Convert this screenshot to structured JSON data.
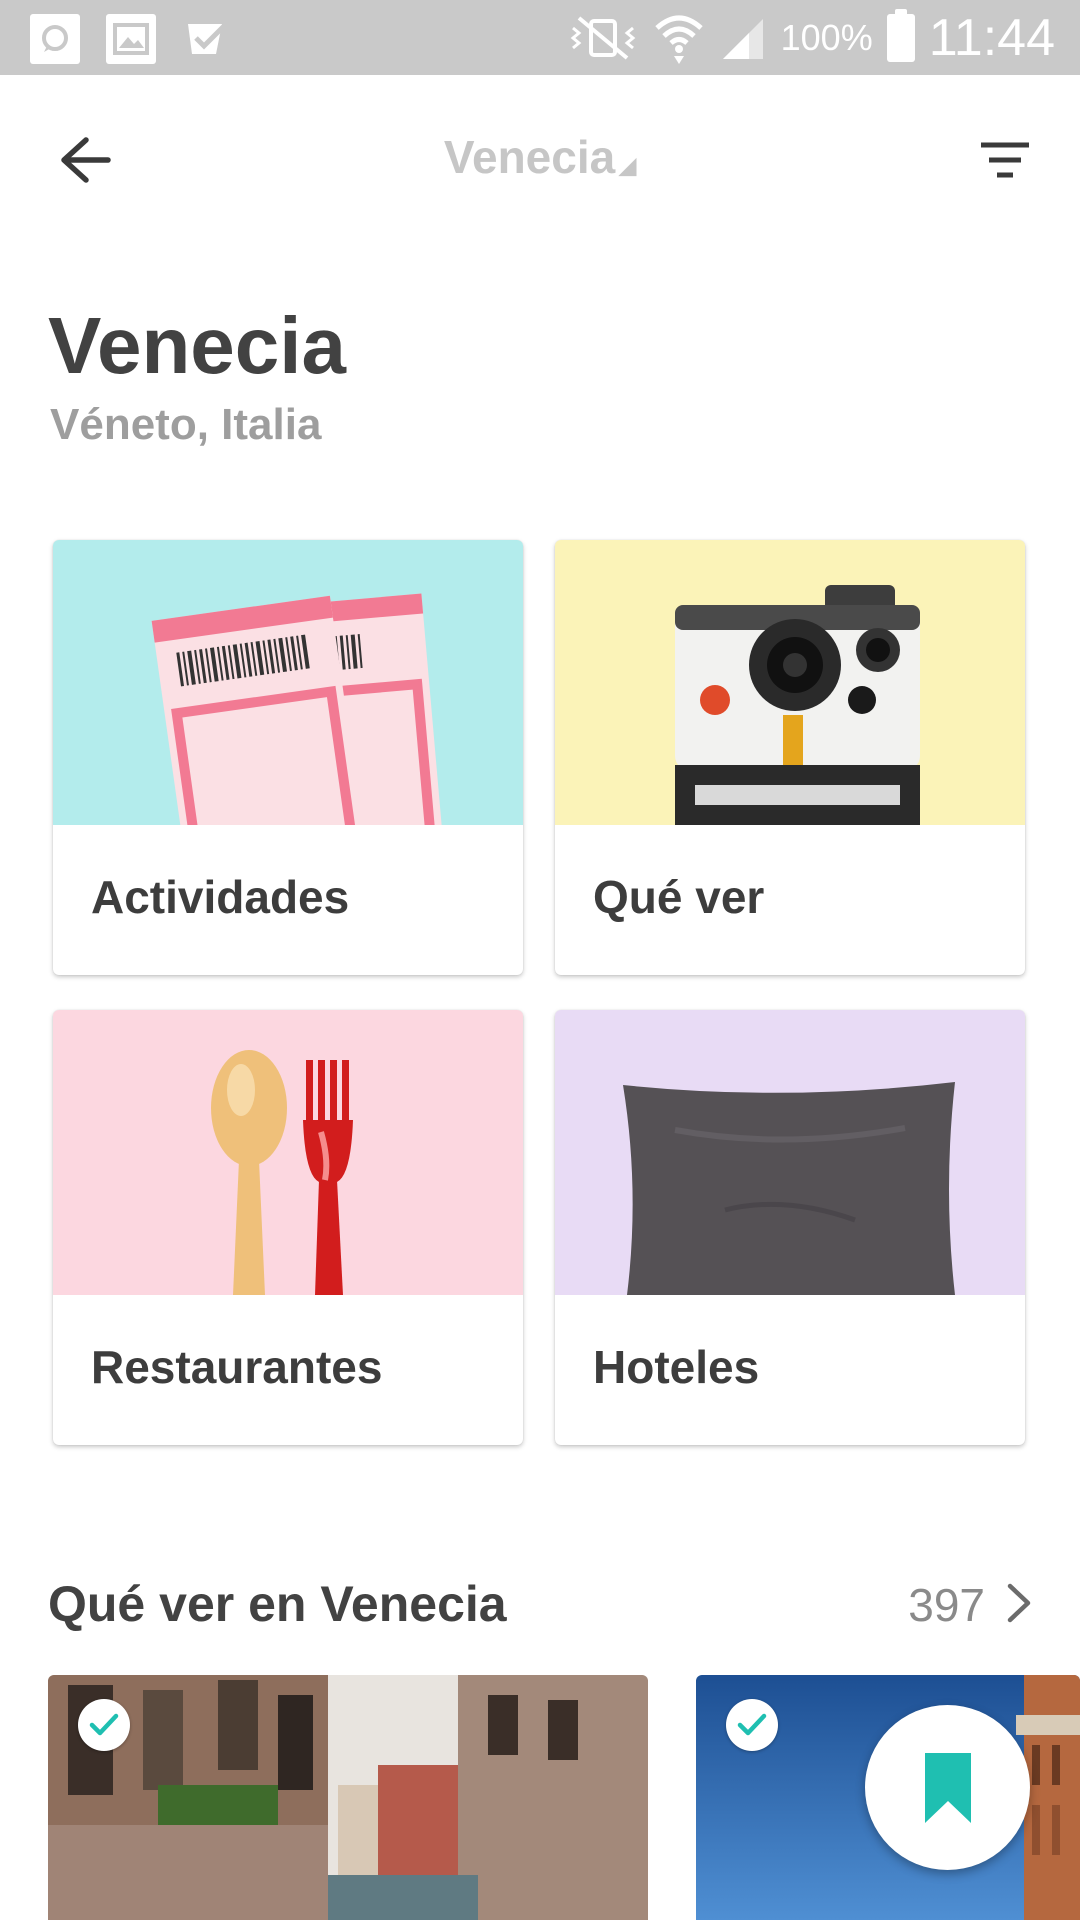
{
  "status_bar": {
    "battery_text": "100%",
    "clock": "11:44"
  },
  "app_bar": {
    "title": "Venecia",
    "caret": "◢"
  },
  "header": {
    "city": "Venecia",
    "region": "Véneto, Italia"
  },
  "categories": [
    {
      "label": "Actividades",
      "bg": "#b3ecec",
      "icon": "tickets-image"
    },
    {
      "label": "Qué ver",
      "bg": "#fbf3b8",
      "icon": "camera-image"
    },
    {
      "label": "Restaurantes",
      "bg": "#fcd7e0",
      "icon": "spoon-fork-image"
    },
    {
      "label": "Hoteles",
      "bg": "#e8dbf5",
      "icon": "pillow-image"
    }
  ],
  "section": {
    "title": "Qué ver en Venecia",
    "count": "397"
  },
  "colors": {
    "accent": "#1fbfb1",
    "status_bar": "#c9c9c9",
    "text_dark": "#424242",
    "text_muted": "#9e9e9e"
  }
}
